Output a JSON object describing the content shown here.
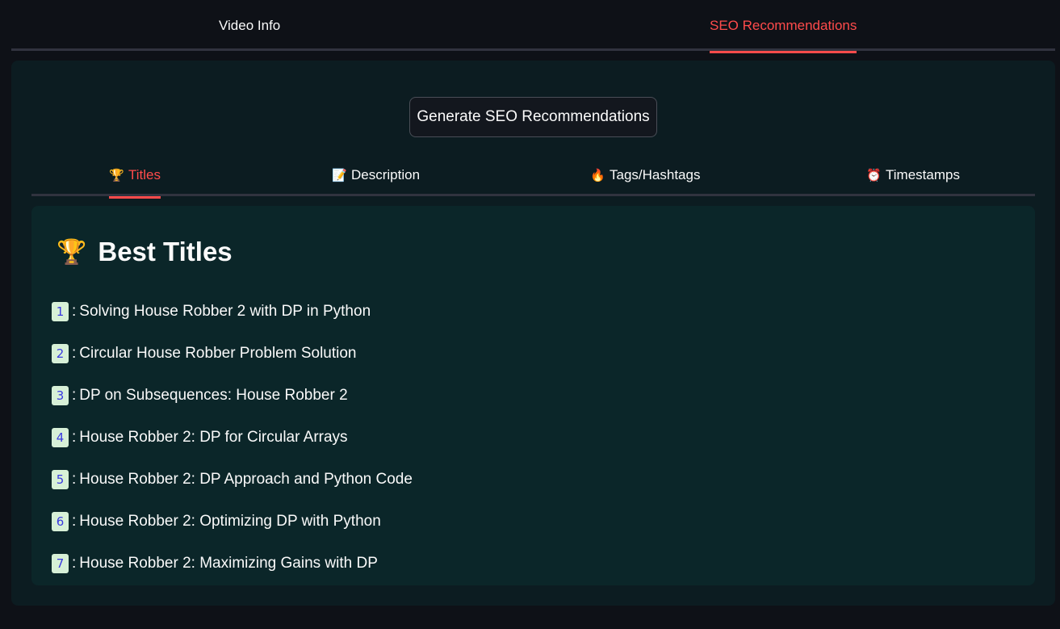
{
  "top_tabs": [
    {
      "label": "Video Info",
      "active": false
    },
    {
      "label": "SEO Recommendations",
      "active": true
    }
  ],
  "generate_button_label": "Generate SEO Recommendations",
  "sub_tabs": [
    {
      "icon": "trophy-icon",
      "glyph": "🏆",
      "label": "Titles",
      "active": true
    },
    {
      "icon": "memo-icon",
      "glyph": "📝",
      "label": "Description",
      "active": false
    },
    {
      "icon": "fire-icon",
      "glyph": "🔥",
      "label": "Tags/Hashtags",
      "active": false
    },
    {
      "icon": "alarm-clock-icon",
      "glyph": "⏰",
      "label": "Timestamps",
      "active": false
    }
  ],
  "titles_section": {
    "heading_icon": "🏆",
    "heading": "Best Titles",
    "separator": ":",
    "items": [
      {
        "num": "1",
        "text": "Solving House Robber 2 with DP in Python"
      },
      {
        "num": "2",
        "text": "Circular House Robber Problem Solution"
      },
      {
        "num": "3",
        "text": "DP on Subsequences: House Robber 2"
      },
      {
        "num": "4",
        "text": "House Robber 2: DP for Circular Arrays"
      },
      {
        "num": "5",
        "text": "House Robber 2: DP Approach and Python Code"
      },
      {
        "num": "6",
        "text": "House Robber 2: Optimizing DP with Python"
      },
      {
        "num": "7",
        "text": "House Robber 2: Maximizing Gains with DP"
      }
    ]
  },
  "colors": {
    "accent": "#ff4b4b",
    "background": "#0e1117",
    "panel": "#0c1c21",
    "inner_panel": "#0b2629",
    "badge_bg": "#d7f0d7",
    "badge_text": "#3a3ae0"
  }
}
